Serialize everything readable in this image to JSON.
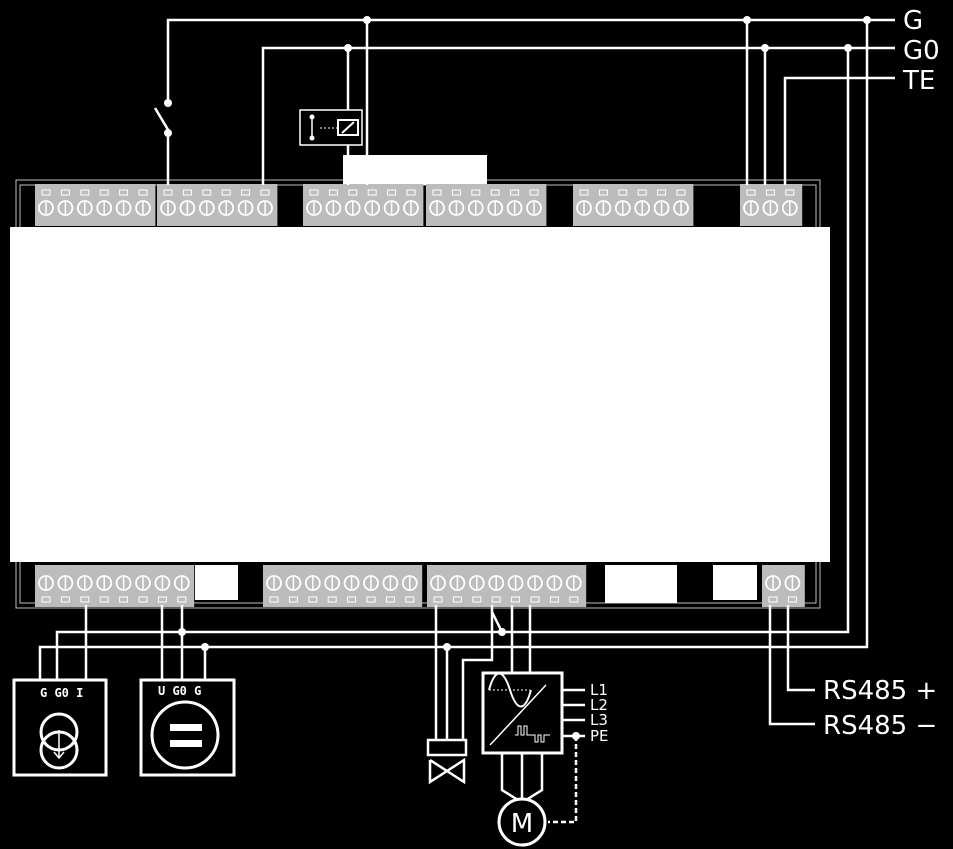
{
  "bus": {
    "g": "G",
    "g0": "G0",
    "te": "TE"
  },
  "rs485": {
    "plus": "RS485 +",
    "minus": "RS485 −"
  },
  "vfd": {
    "l1": "L1",
    "l2": "L2",
    "l3": "L3",
    "pe": "PE"
  },
  "motor": {
    "label": "M"
  },
  "current_sensor": {
    "terminals": "G G0 I"
  },
  "voltage_sensor": {
    "terminals": "U G0 G"
  },
  "colors": {
    "background": "#000000",
    "wire": "#ffffff",
    "terminal": "#bcbcbc",
    "housing": "#ffffff"
  }
}
